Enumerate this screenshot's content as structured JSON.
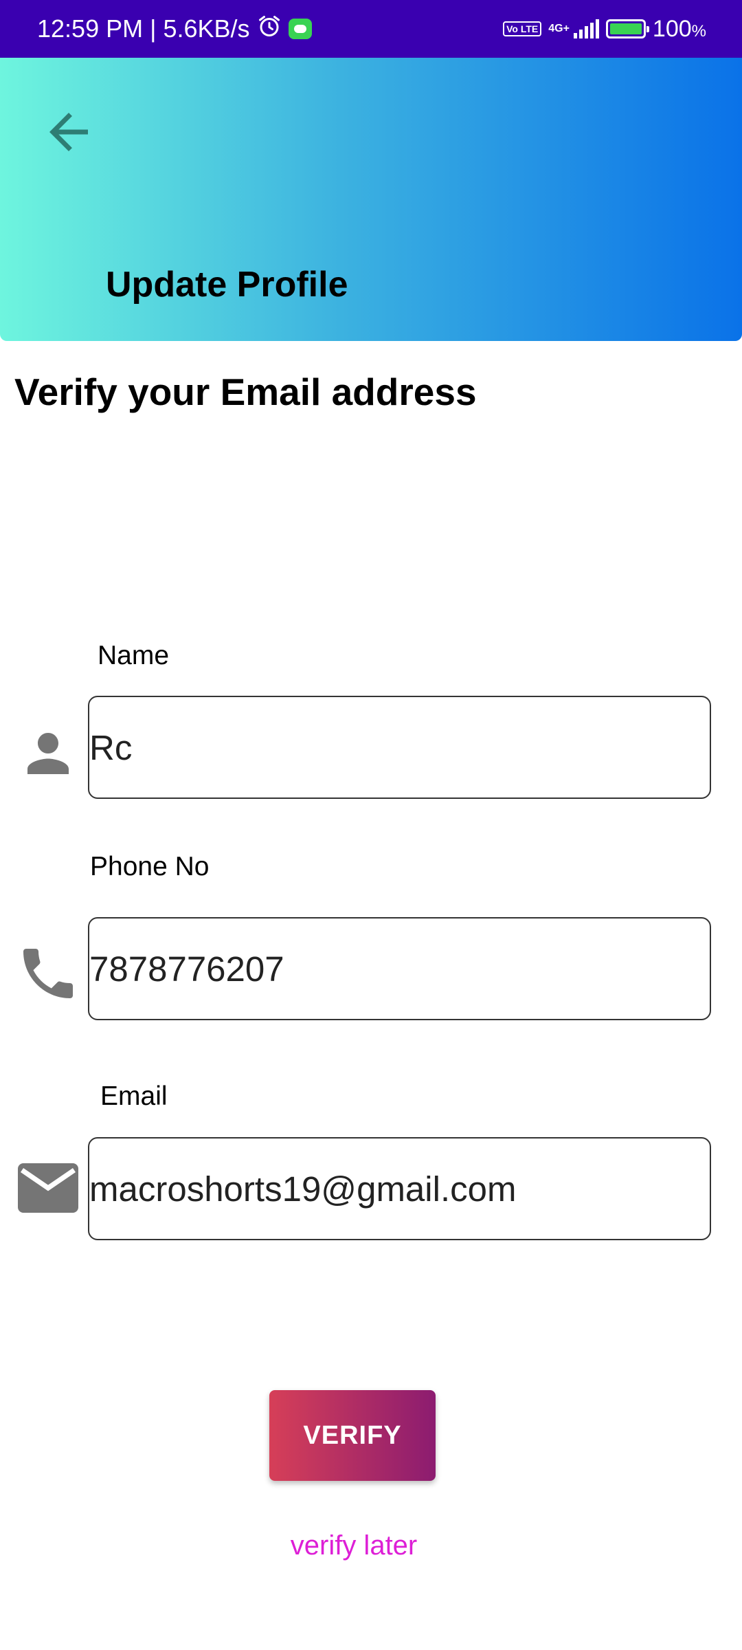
{
  "status_bar": {
    "time_speed": "12:59 PM | 5.6KB/s",
    "network": "4G+",
    "volte": "Vo LTE",
    "battery_level": "100",
    "battery_pct_sign": "%"
  },
  "header": {
    "title": "Update Profile"
  },
  "subtitle": "Verify your Email address",
  "form": {
    "name": {
      "label": "Name",
      "value": "Rc"
    },
    "phone": {
      "label": "Phone No",
      "value": "7878776207"
    },
    "email": {
      "label": "Email",
      "value": "macroshorts19@gmail.com"
    }
  },
  "actions": {
    "verify_label": "VERIFY",
    "verify_later_label": "verify later"
  },
  "colors": {
    "status_bar": "#3a00b0",
    "header_gradient_start": "#6ef5de",
    "header_gradient_end": "#0a72e8",
    "button_gradient_start": "#d63f58",
    "button_gradient_end": "#8c1c70",
    "link": "#dd1fd6",
    "icon_gray": "#757575",
    "back_arrow": "#2e7d74"
  },
  "icons": {
    "back": "arrow-left-icon",
    "name": "person-icon",
    "phone": "phone-icon",
    "email": "mail-icon"
  }
}
